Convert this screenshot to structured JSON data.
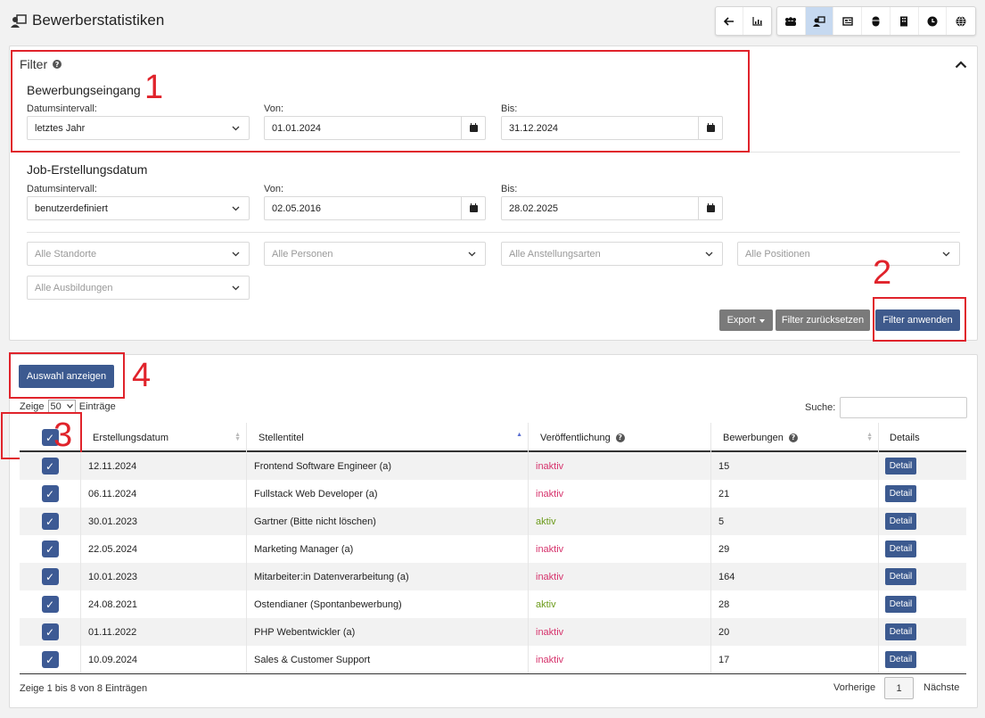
{
  "page": {
    "title": "Bewerberstatistiken"
  },
  "toolbar": {
    "group1": [
      {
        "icon": "arrow-left-icon",
        "glyph": "🡐"
      },
      {
        "icon": "chart-icon",
        "glyph": "▥"
      }
    ],
    "group2": [
      {
        "icon": "users-icon",
        "glyph": "⁂"
      },
      {
        "icon": "applicant-stats-icon",
        "glyph": "▣"
      },
      {
        "icon": "newspaper-icon",
        "glyph": "▤"
      },
      {
        "icon": "mouse-icon",
        "glyph": "●"
      },
      {
        "icon": "building-icon",
        "glyph": "▮"
      },
      {
        "icon": "clock-icon",
        "glyph": "◔"
      },
      {
        "icon": "globe-icon",
        "glyph": "◍"
      }
    ]
  },
  "filter": {
    "title": "Filter",
    "help": "?",
    "application_section": {
      "title": "Bewerbungseingang",
      "interval_label": "Datumsintervall:",
      "interval_value": "letztes Jahr",
      "from_label": "Von:",
      "from_value": "01.01.2024",
      "to_label": "Bis:",
      "to_value": "31.12.2024"
    },
    "job_section": {
      "title": "Job-Erstellungsdatum",
      "interval_label": "Datumsintervall:",
      "interval_value": "benutzerdefiniert",
      "from_label": "Von:",
      "from_value": "02.05.2016",
      "to_label": "Bis:",
      "to_value": "28.02.2025"
    },
    "selects": {
      "locations": "Alle Standorte",
      "persons": "Alle Personen",
      "employment_types": "Alle Anstellungsarten",
      "positions": "Alle Positionen",
      "trainings": "Alle Ausbildungen"
    },
    "buttons": {
      "export": "Export",
      "reset": "Filter zurücksetzen",
      "apply": "Filter anwenden"
    }
  },
  "annotations": [
    "1",
    "2",
    "3",
    "4"
  ],
  "results": {
    "show_selection": "Auswahl anzeigen",
    "show_label": "Zeige",
    "page_size": "50",
    "entries_label": "Einträge",
    "search_label": "Suche:",
    "search_value": "",
    "columns": [
      "Erstellungsdatum",
      "Stellentitel",
      "Veröffentlichung",
      "Bewerbungen",
      "Details"
    ],
    "rows": [
      {
        "date": "12.11.2024",
        "title": "Frontend Software Engineer (a)",
        "status": "inaktiv",
        "count": "15",
        "detail": "Detail"
      },
      {
        "date": "06.11.2024",
        "title": "Fullstack Web Developer (a)",
        "status": "inaktiv",
        "count": "21",
        "detail": "Detail"
      },
      {
        "date": "30.01.2023",
        "title": "Gartner (Bitte nicht löschen)",
        "status": "aktiv",
        "count": "5",
        "detail": "Detail"
      },
      {
        "date": "22.05.2024",
        "title": "Marketing Manager (a)",
        "status": "inaktiv",
        "count": "29",
        "detail": "Detail"
      },
      {
        "date": "10.01.2023",
        "title": "Mitarbeiter:in Datenverarbeitung (a)",
        "status": "inaktiv",
        "count": "164",
        "detail": "Detail"
      },
      {
        "date": "24.08.2021",
        "title": "Ostendianer (Spontanbewerbung)",
        "status": "aktiv",
        "count": "28",
        "detail": "Detail"
      },
      {
        "date": "01.11.2022",
        "title": "PHP Webentwickler (a)",
        "status": "inaktiv",
        "count": "20",
        "detail": "Detail"
      },
      {
        "date": "10.09.2024",
        "title": "Sales & Customer Support",
        "status": "inaktiv",
        "count": "17",
        "detail": "Detail"
      }
    ],
    "footer_info": "Zeige 1 bis 8 von 8 Einträgen",
    "prev": "Vorherige",
    "page": "1",
    "next": "Nächste"
  }
}
